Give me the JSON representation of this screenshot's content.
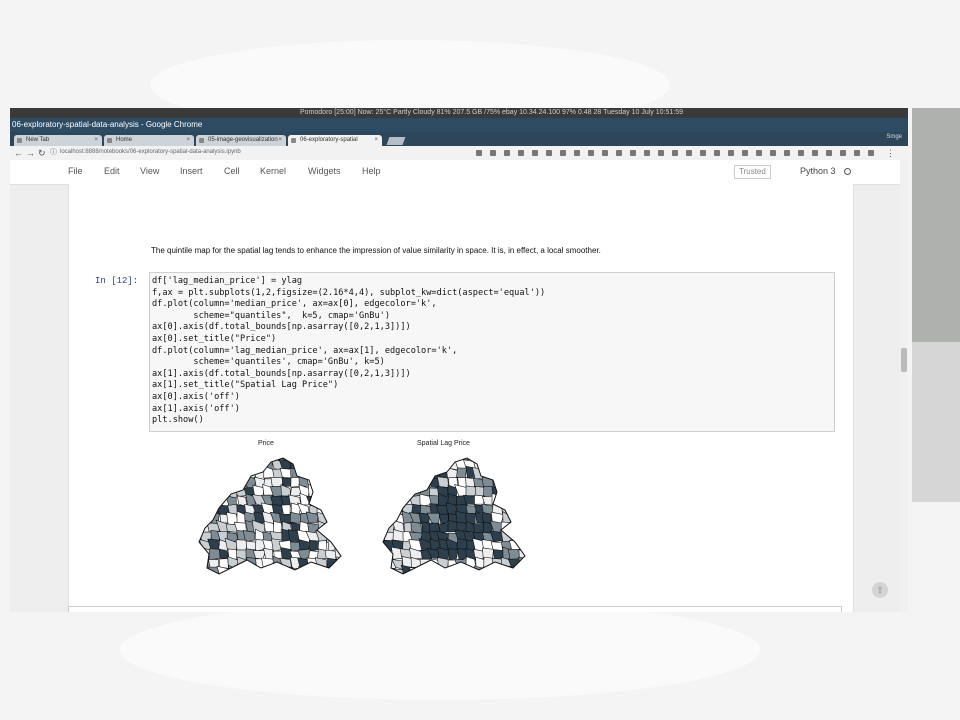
{
  "system_bar": {
    "left": "",
    "right": "Pomodoro [25:00]  Now: 25°C Partly Cloudy  81%  207.5 GB  /75%  ebay  10.34.24.100  97%  0.48  28  Tuesday 10 July  10:51:59"
  },
  "window": {
    "title": "06-exploratory-spatial-data-analysis - Google Chrome"
  },
  "tabs": [
    {
      "label": "New Tab"
    },
    {
      "label": "Home"
    },
    {
      "label": "05-image-geovisualization"
    },
    {
      "label": "06-exploratory-spatial"
    }
  ],
  "signin": "Smge",
  "address": {
    "url": "localhost:8888/notebooks/06-exploratory-spatial-data-analysis.ipynb"
  },
  "menu": [
    "File",
    "Edit",
    "View",
    "Insert",
    "Cell",
    "Kernel",
    "Widgets",
    "Help"
  ],
  "trusted": "Trusted",
  "kernel": "Python 3",
  "markdown": "The quintile map for the spatial lag tends to enhance the impression of value similarity in space. It is, in effect, a local smoother.",
  "cell": {
    "prompt": "In [12]:",
    "code": "df['lag_median_price'] = ylag\nf,ax = plt.subplots(1,2,figsize=(2.16*4,4), subplot_kw=dict(aspect='equal'))\ndf.plot(column='median_price', ax=ax[0], edgecolor='k',\n        scheme=\"quantiles\",  k=5, cmap='GnBu')\nax[0].axis(df.total_bounds[np.asarray([0,2,1,3])])\nax[0].set_title(\"Price\")\ndf.plot(column='lag_median_price', ax=ax[1], edgecolor='k',\n        scheme='quantiles', cmap='GnBu', k=5)\nax[1].axis(df.total_bounds[np.asarray([0,2,1,3])])\nax[1].set_title(\"Spatial Lag Price\")\nax[0].axis('off')\nax[1].axis('off')\nplt.show()"
  },
  "figures": [
    {
      "title": "Price"
    },
    {
      "title": "Spatial Lag Price"
    }
  ],
  "colors": {
    "dark": "#2d3f4c",
    "mid": "#7e8c95",
    "light": "#c9cfd3",
    "pale": "#eceeef",
    "white": "#ffffff"
  }
}
